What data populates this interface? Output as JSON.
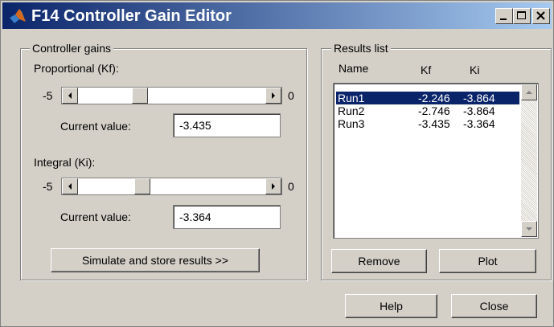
{
  "window": {
    "title": "F14 Controller Gain Editor"
  },
  "controller_gains": {
    "legend": "Controller gains",
    "proportional": {
      "label": "Proportional (Kf):",
      "min_label": "-5",
      "max_label": "0",
      "slider_value": -3.435,
      "current_label": "Current value:",
      "current_value": "-3.435"
    },
    "integral": {
      "label": "Integral (Ki):",
      "min_label": "-5",
      "max_label": "0",
      "slider_value": -3.364,
      "current_label": "Current value:",
      "current_value": "-3.364"
    },
    "simulate_label": "Simulate and store results >>"
  },
  "results": {
    "legend": "Results list",
    "headers": {
      "name": "Name",
      "kf": "Kf",
      "ki": "Ki"
    },
    "rows": [
      {
        "name": "Run1",
        "kf": "-2.246",
        "ki": "-3.864",
        "selected": true
      },
      {
        "name": "Run2",
        "kf": "-2.746",
        "ki": "-3.864",
        "selected": false
      },
      {
        "name": "Run3",
        "kf": "-3.435",
        "ki": "-3.364",
        "selected": false
      }
    ],
    "remove_label": "Remove",
    "plot_label": "Plot"
  },
  "footer": {
    "help_label": "Help",
    "close_label": "Close"
  },
  "colors": {
    "title_bar": "#0a246a",
    "selection": "#0a246a",
    "face": "#d4d0c8"
  },
  "icons": [
    "matlab-logo-icon",
    "minimize-icon",
    "maximize-icon",
    "close-icon",
    "arrow-left-icon",
    "arrow-right-icon",
    "arrow-up-icon",
    "arrow-down-icon"
  ]
}
